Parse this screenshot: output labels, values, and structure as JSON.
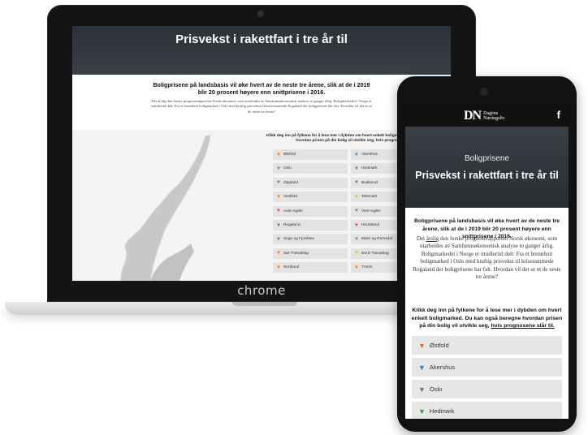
{
  "laptop": {
    "brand_label": "chrome",
    "headline": "Prisvekst i rakettfart i tre år til",
    "intro_heading": "Boligprisene på landsbasis vil øke hvert av de neste tre årene, slik at de i 2019 blir 20 prosent høyere enn snittprisene i 2016.",
    "intro_text": "Det årslig den ferske prognoserapporten Norsk økonomi, som utarbeides av Samfunnsøkonomisk analyse to ganger årlig. Boligmarkedet i Norge er imidlertid delt: Fra et brennhott boligmarked i Oslo med kraftig prisvekst til kriserammede Rogaland der boligprisene har falt. Hvordan vil det se ut de neste tre årene?",
    "klikk_text": "Klikk deg inn på fylkene for å lese mer i dybden om hvert enkelt boligmarked. Du kan også beregne hvordan prisen på din bolig vil utvikle seg, hvis prognosene slår til.",
    "counties": [
      {
        "name": "Østfold",
        "icon": "shield-icon",
        "color": "#e8731a"
      },
      {
        "name": "Akershus",
        "icon": "shield-icon",
        "color": "#2f7fc1"
      },
      {
        "name": "Oslo",
        "icon": "shield-icon",
        "color": "#777777"
      },
      {
        "name": "Hedmark",
        "icon": "shield-icon",
        "color": "#3a9a46"
      },
      {
        "name": "Oppland",
        "icon": "shield-icon",
        "color": "#3a9a46"
      },
      {
        "name": "Buskerud",
        "icon": "shield-icon",
        "color": "#2f7fc1"
      },
      {
        "name": "Vestfold",
        "icon": "shield-icon",
        "color": "#e8731a"
      },
      {
        "name": "Telemark",
        "icon": "shield-icon",
        "color": "#e8b21a"
      },
      {
        "name": "Aust-Agder",
        "icon": "shield-icon",
        "color": "#d9342b"
      },
      {
        "name": "Vest-Agder",
        "icon": "shield-icon",
        "color": "#3a9a46"
      },
      {
        "name": "Rogaland",
        "icon": "shield-icon",
        "color": "#2f7fc1"
      },
      {
        "name": "Hordaland",
        "icon": "shield-icon",
        "color": "#d9342b"
      },
      {
        "name": "Sogn og Fjordane",
        "icon": "shield-icon",
        "color": "#2f7fc1"
      },
      {
        "name": "Møre og Romsdal",
        "icon": "shield-icon",
        "color": "#3a9a46"
      },
      {
        "name": "Sør-Trøndelag",
        "icon": "shield-icon",
        "color": "#e8731a"
      },
      {
        "name": "Nord-Trøndelag",
        "icon": "shield-icon",
        "color": "#e8b21a"
      },
      {
        "name": "Nordland",
        "icon": "shield-icon",
        "color": "#e8731a"
      },
      {
        "name": "Troms",
        "icon": "shield-icon",
        "color": "#e8731a"
      }
    ]
  },
  "phone": {
    "logo_mark": "DN",
    "logo_text": "Dagens Næringsliv",
    "facebook_label": "f",
    "kicker": "Boligprisene",
    "headline": "Prisvekst i rakettfart i tre år til",
    "intro_heading": "Boligprisene på landsbasis vil øke hvert av de neste tre årene, slik at de i 2019 blir 20 prosent høyere enn snittprisene i 2016.",
    "intro_text_pre": "Det",
    "intro_link": "årslig",
    "intro_text_post": "den ferske prognoserapporten Norsk økonomi, som utarbeides av Samfunnsøkonomisk analyse to ganger årlig. Boligmarkedet i Norge er imidlertid delt: Fra et brennhott boligmarked i Oslo med kraftig prisvekst til kriserammede Rogaland der boligprisene har falt. Hvordan vil det se ut de neste tre årene?",
    "klikk_text": "Klikk deg inn på fylkene for å lese mer i dybden om hvert enkelt boligmarked. Du kan også beregne hvordan prisen på din bolig vil utvikle seg,",
    "klikk_link": "hvis prognosene slår til.",
    "counties": [
      {
        "name": "Østfold",
        "icon": "shield-icon",
        "color": "#e8731a"
      },
      {
        "name": "Akershus",
        "icon": "shield-icon",
        "color": "#2f7fc1"
      },
      {
        "name": "Oslo",
        "icon": "shield-icon",
        "color": "#777777"
      },
      {
        "name": "Hedmark",
        "icon": "shield-icon",
        "color": "#3a9a46"
      }
    ]
  }
}
